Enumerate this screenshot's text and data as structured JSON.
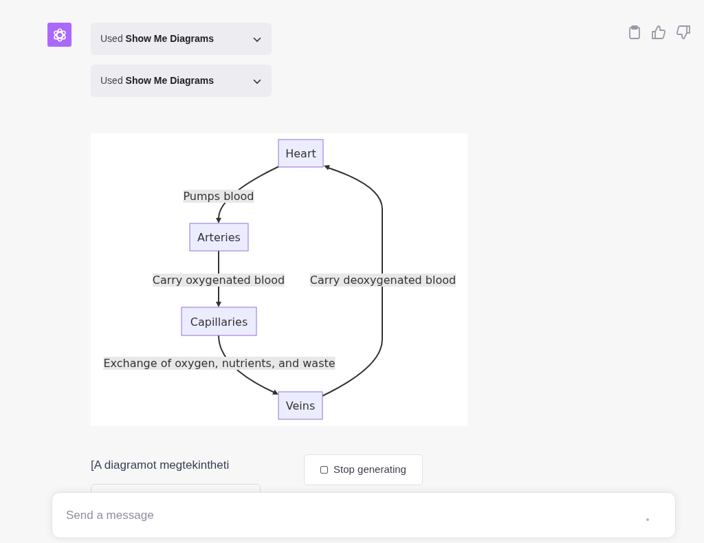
{
  "assistant": {
    "tool_calls": [
      {
        "prefix": "Used",
        "plugin": "Show Me Diagrams",
        "expanded": false
      },
      {
        "prefix": "Used",
        "plugin": "Show Me Diagrams",
        "expanded": false
      }
    ],
    "diagram": {
      "nodes": [
        {
          "label": "Heart"
        },
        {
          "label": "Arteries"
        },
        {
          "label": "Capillaries"
        },
        {
          "label": "Veins"
        }
      ],
      "edges": [
        {
          "label": "Pumps blood"
        },
        {
          "label": "Carry oxygenated blood"
        },
        {
          "label": "Exchange of oxygen, nutrients, and waste"
        },
        {
          "label": "Carry deoxygenated blood"
        }
      ]
    },
    "message_text": "[A diagramot megtekintheti"
  },
  "stop_button": {
    "label": "Stop generating"
  },
  "composer": {
    "placeholder": "Send a message"
  }
}
